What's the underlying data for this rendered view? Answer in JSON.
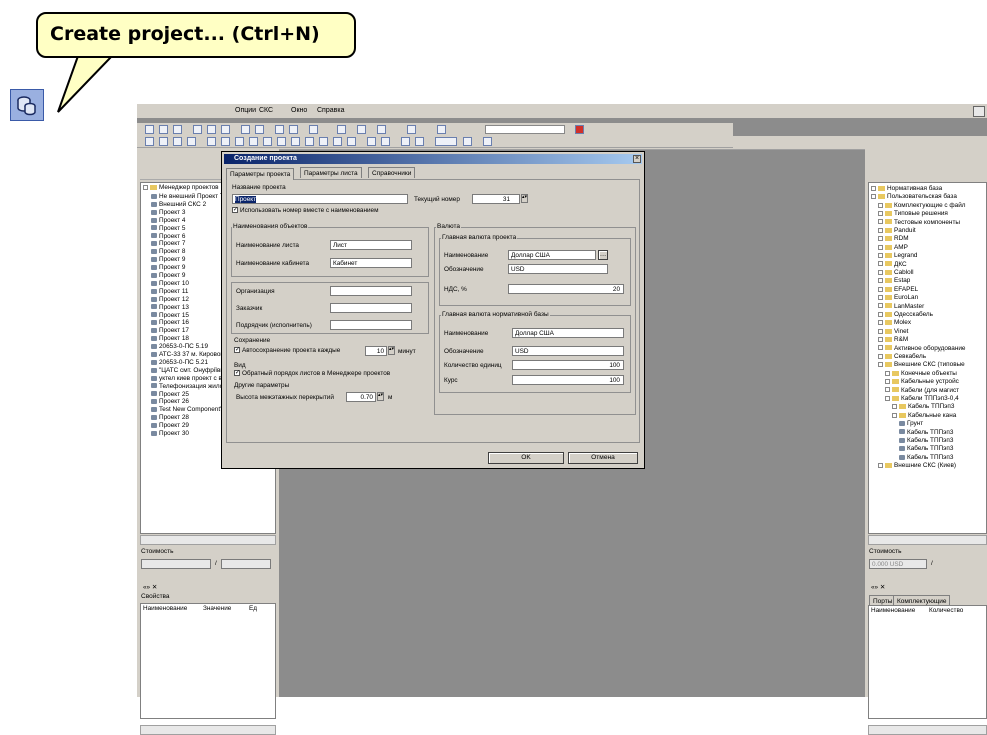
{
  "tooltip": {
    "text": "Create project... (Ctrl+N)"
  },
  "menu": [
    "Опции",
    "СКС",
    "Окно",
    "Справка"
  ],
  "left_panel": {
    "root": "Менеджер проектов",
    "items": [
      "Не внешний Проект The 8",
      "Внешний СКС 2",
      "Проект 3",
      "Проект 4",
      "Проект 5",
      "Проект 6",
      "Проект 7",
      "Проект 8",
      "Проект 9",
      "Проект 9",
      "Проект 9",
      "Проект 10",
      "Проект 11",
      "Проект 12",
      "Проект 13",
      "Проект 15",
      "Проект 16",
      "Проект 17",
      "Проект 18",
      "20653-0-ПС 5.19",
      "АТС-33 37 м. Кировограда",
      "20653-0-ПС 5.21",
      "\"ЦАТС смт. Онуфріївка\" 22",
      "уктел киев проект с визио",
      "Телефонизация жилового б",
      "Проект 25",
      "Проект 26",
      "Test New Component's 27",
      "Проект 28",
      "Проект 29",
      "Проект 30"
    ],
    "cost_label": "Стоимость",
    "cost_sep": "/",
    "props_title": "Свойства",
    "props_columns": [
      "Наименование",
      "Значение",
      "Ед"
    ]
  },
  "right_panel": {
    "items": [
      {
        "label": "Нормативная база",
        "level": 0
      },
      {
        "label": "Пользовательская база",
        "level": 0
      },
      {
        "label": "Комплектующие с файл",
        "level": 1
      },
      {
        "label": "Типовые решения",
        "level": 1
      },
      {
        "label": "Тестовые компоненты",
        "level": 1
      },
      {
        "label": "Panduit",
        "level": 1
      },
      {
        "label": "RDM",
        "level": 1
      },
      {
        "label": "AMP",
        "level": 1
      },
      {
        "label": "Legrand",
        "level": 1
      },
      {
        "label": "ДКС",
        "level": 1
      },
      {
        "label": "Cabloll",
        "level": 1
      },
      {
        "label": "Estap",
        "level": 1
      },
      {
        "label": "EFAPEL",
        "level": 1
      },
      {
        "label": "EuroLan",
        "level": 1
      },
      {
        "label": "LanMaster",
        "level": 1
      },
      {
        "label": "Одесскабель",
        "level": 1
      },
      {
        "label": "Molex",
        "level": 1
      },
      {
        "label": "Vinet",
        "level": 1
      },
      {
        "label": "R&M",
        "level": 1
      },
      {
        "label": "Активное оборудование",
        "level": 1
      },
      {
        "label": "Севкабель",
        "level": 1
      },
      {
        "label": "Внешние СКС (типовые",
        "level": 1
      },
      {
        "label": "Конечные объекты",
        "level": 2
      },
      {
        "label": "Кабельные устройс",
        "level": 2
      },
      {
        "label": "Кабели (для магист",
        "level": 2
      },
      {
        "label": "Кабели ТППэп3-0,4",
        "level": 2
      },
      {
        "label": "Кабель ТППэп3",
        "level": 3
      },
      {
        "label": "Кабельные кана",
        "level": 3
      },
      {
        "label": "Грунт",
        "level": 4
      },
      {
        "label": "Кабель ТППэп3",
        "level": 4
      },
      {
        "label": "Кабель ТППэп3",
        "level": 4
      },
      {
        "label": "Кабель ТППэп3",
        "level": 4
      },
      {
        "label": "Кабель ТППэп3",
        "level": 4
      },
      {
        "label": "Внешние СКС (Киев)",
        "level": 1
      }
    ],
    "cost_label": "Стоимость",
    "cost_value": "0.000 USD",
    "tabs": [
      "Порты",
      "Комплектующие"
    ],
    "columns": [
      "Наименование",
      "Количество"
    ]
  },
  "dialog": {
    "title": "Создание проекта",
    "tabs": [
      "Параметры проекта",
      "Параметры листа",
      "Справочники"
    ],
    "project_name_label": "Название проекта",
    "project_name_value": "Проект",
    "current_number_label": "Текущий номер",
    "current_number_value": "31",
    "use_number_label": "Использовать номер вместе с наименованием",
    "objects_group": "Наименования объектов",
    "sheet_name_label": "Наименование листа",
    "sheet_name_value": "Лист",
    "cabinet_name_label": "Наименование кабинета",
    "cabinet_name_value": "Кабинет",
    "org_label": "Организация",
    "customer_label": "Заказчик",
    "contractor_label": "Подрядчик (исполнитель)",
    "save_group": "Сохранение",
    "autosave_label": "Автосохранение проекта каждые",
    "autosave_value": "10",
    "autosave_unit": "минут",
    "view_group": "Вид",
    "reverse_order_label": "Обратный порядок листов в Менеджере проектов",
    "other_group": "Другие параметры",
    "ceiling_label": "Высота межэтажных перекрытий",
    "ceiling_value": "0.70",
    "ceiling_unit": "м",
    "currency_group": "Валюта",
    "main_currency_group": "Главная валюта проекта",
    "name_label": "Наименование",
    "name_value": "Доллар США",
    "symbol_label": "Обозначение",
    "symbol_value": "USD",
    "vat_label": "НДС, %",
    "vat_value": "20",
    "base_currency_group": "Главная валюта нормативной базы",
    "base_name_label": "Наименование",
    "base_name_value": "Доллар США",
    "base_symbol_label": "Обозначение",
    "base_symbol_value": "USD",
    "units_label": "Количество единиц",
    "units_value": "100",
    "rate_label": "Курс",
    "rate_value": "100",
    "ok": "OK",
    "cancel": "Отмена",
    "close_glyph": "×"
  }
}
